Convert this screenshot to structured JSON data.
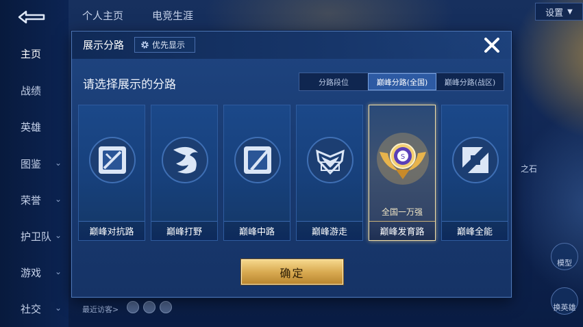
{
  "background": {
    "top_tabs": [
      "个人主页",
      "电竞生涯"
    ],
    "settings_label": "设置",
    "sidebar": [
      {
        "label": "主页",
        "active": true,
        "has_chevron": false
      },
      {
        "label": "战绩",
        "active": false,
        "has_chevron": false
      },
      {
        "label": "英雄",
        "active": false,
        "has_chevron": false
      },
      {
        "label": "图鉴",
        "active": false,
        "has_chevron": true
      },
      {
        "label": "荣誉",
        "active": false,
        "has_chevron": true
      },
      {
        "label": "护卫队",
        "active": false,
        "has_chevron": true
      },
      {
        "label": "游戏",
        "active": false,
        "has_chevron": true
      },
      {
        "label": "社交",
        "active": false,
        "has_chevron": true
      }
    ],
    "recent_visitors_label": "最近访客>",
    "side_text_partial": "之石",
    "right_button_label_1": "模型",
    "right_button_label_2": "换英雄"
  },
  "modal": {
    "title": "展示分路",
    "priority_button_label": "优先显示",
    "subtitle": "请选择展示的分路",
    "segments": [
      {
        "label": "分路段位",
        "active": false
      },
      {
        "label": "巅峰分路(全国)",
        "active": true
      },
      {
        "label": "巅峰分路(战区)",
        "active": false
      }
    ],
    "cards": [
      {
        "label": "巅峰对抗路",
        "icon": "sword-shield-icon",
        "rank": "",
        "selected": false
      },
      {
        "label": "巅峰打野",
        "icon": "dragon-icon",
        "rank": "",
        "selected": false
      },
      {
        "label": "巅峰中路",
        "icon": "staff-icon",
        "rank": "",
        "selected": false
      },
      {
        "label": "巅峰游走",
        "icon": "wings-shield-icon",
        "rank": "",
        "selected": false
      },
      {
        "label": "巅峰发育路",
        "icon": "gold-badge-icon",
        "rank": "全国一万强",
        "selected": true
      },
      {
        "label": "巅峰全能",
        "icon": "versatile-icon",
        "rank": "",
        "selected": false
      }
    ],
    "confirm_label": "确定"
  },
  "colors": {
    "accent_gold": "#d9ab52",
    "modal_blue": "#1f4581",
    "selected_border": "#f3e0a8"
  }
}
